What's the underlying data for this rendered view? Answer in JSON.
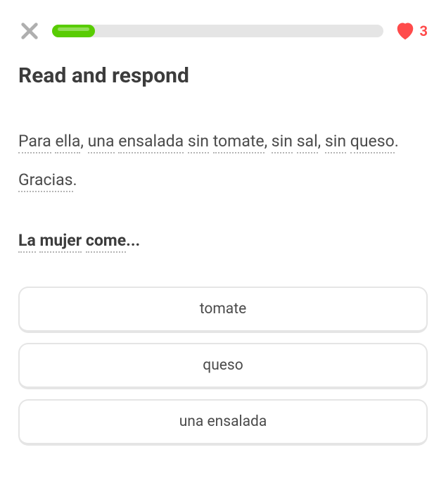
{
  "header": {
    "progress_percent": 13,
    "hearts_count": "3"
  },
  "instruction": "Read and respond",
  "context_words": [
    {
      "text": "Para",
      "dotted": true
    },
    {
      "text": " ",
      "dotted": false
    },
    {
      "text": "ella",
      "dotted": true
    },
    {
      "text": ", ",
      "dotted": false
    },
    {
      "text": "una",
      "dotted": true
    },
    {
      "text": " ",
      "dotted": false
    },
    {
      "text": "ensalada",
      "dotted": true
    },
    {
      "text": " ",
      "dotted": false
    },
    {
      "text": "sin",
      "dotted": true
    },
    {
      "text": " ",
      "dotted": false
    },
    {
      "text": "tomate",
      "dotted": true
    },
    {
      "text": ", ",
      "dotted": false
    },
    {
      "text": "sin",
      "dotted": true
    },
    {
      "text": " ",
      "dotted": false
    },
    {
      "text": "sal",
      "dotted": true
    },
    {
      "text": ", ",
      "dotted": false
    },
    {
      "text": "sin",
      "dotted": true
    },
    {
      "text": " ",
      "dotted": false
    },
    {
      "text": "queso",
      "dotted": true
    },
    {
      "text": ". ",
      "dotted": false
    },
    {
      "text": "Gracias",
      "dotted": true
    },
    {
      "text": ".",
      "dotted": false
    }
  ],
  "question_words": [
    {
      "text": "La",
      "dotted": true
    },
    {
      "text": " ",
      "dotted": false
    },
    {
      "text": "mujer",
      "dotted": true
    },
    {
      "text": " ",
      "dotted": false
    },
    {
      "text": "come",
      "dotted": true
    },
    {
      "text": "...",
      "dotted": false
    }
  ],
  "options": [
    {
      "label": "tomate"
    },
    {
      "label": "queso"
    },
    {
      "label": "una ensalada"
    }
  ]
}
